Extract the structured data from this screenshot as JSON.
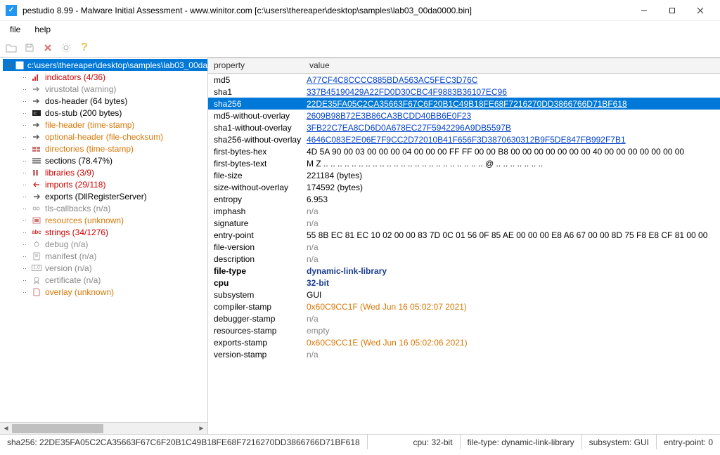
{
  "window": {
    "title": "pestudio 8.99 - Malware Initial Assessment - www.winitor.com [c:\\users\\thereaper\\desktop\\samples\\lab03_00da0000.bin]"
  },
  "menus": {
    "file": "file",
    "help": "help"
  },
  "tree": {
    "root": "c:\\users\\thereaper\\desktop\\samples\\lab03_00da",
    "items": [
      {
        "label": "indicators (4/36)",
        "cls": "c-red",
        "icon": "bars"
      },
      {
        "label": "virustotal (warning)",
        "cls": "c-gray",
        "icon": "arrow-r"
      },
      {
        "label": "dos-header (64 bytes)",
        "cls": "",
        "icon": "arrow-o"
      },
      {
        "label": "dos-stub (200 bytes)",
        "cls": "",
        "icon": "console"
      },
      {
        "label": "file-header (time-stamp)",
        "cls": "c-orange",
        "icon": "arrow-o"
      },
      {
        "label": "optional-header (file-checksum)",
        "cls": "c-orange",
        "icon": "arrow-o"
      },
      {
        "label": "directories (time-stamp)",
        "cls": "c-orange",
        "icon": "dirs"
      },
      {
        "label": "sections (78.47%)",
        "cls": "",
        "icon": "sections"
      },
      {
        "label": "libraries (3/9)",
        "cls": "c-red",
        "icon": "libs"
      },
      {
        "label": "imports (29/118)",
        "cls": "c-red",
        "icon": "imports"
      },
      {
        "label": "exports (DllRegisterServer)",
        "cls": "",
        "icon": "exports"
      },
      {
        "label": "tls-callbacks (n/a)",
        "cls": "c-gray",
        "icon": "chain"
      },
      {
        "label": "resources (unknown)",
        "cls": "c-orange",
        "icon": "res"
      },
      {
        "label": "strings (34/1276)",
        "cls": "c-red",
        "icon": "abc"
      },
      {
        "label": "debug (n/a)",
        "cls": "c-gray",
        "icon": "bug"
      },
      {
        "label": "manifest (n/a)",
        "cls": "c-gray",
        "icon": "manifest"
      },
      {
        "label": "version (n/a)",
        "cls": "c-gray",
        "icon": "ver"
      },
      {
        "label": "certificate (n/a)",
        "cls": "c-gray",
        "icon": "cert"
      },
      {
        "label": "overlay (unknown)",
        "cls": "c-orange",
        "icon": "file"
      }
    ]
  },
  "properties": {
    "headers": {
      "property": "property",
      "value": "value"
    },
    "rows": [
      {
        "prop": "md5",
        "val": "A77CF4C8CCCC885BDA563AC5FEC3D76C",
        "vcls": "c-blue"
      },
      {
        "prop": "sha1",
        "val": "337B45190429A22FD0D30CBC4F9883B36107EC96",
        "vcls": "c-blue"
      },
      {
        "prop": "sha256",
        "val": "22DE35FA05C2CA35663F67C6F20B1C49B18FE68F7216270DD3866766D71BF618",
        "vcls": "c-blue",
        "selected": true
      },
      {
        "prop": "md5-without-overlay",
        "val": "2609B98B72E3B86CA3BCDD40BB6E0F23",
        "vcls": "c-blue"
      },
      {
        "prop": "sha1-without-overlay",
        "val": "3FB22C7EA8CD6D0A678EC27F5942296A9DB5597B",
        "vcls": "c-blue"
      },
      {
        "prop": "sha256-without-overlay",
        "val": "4646C083E2E06E7F9CC2D72010B41F656F3D3870630312B9F5DE847FB992F7B1",
        "vcls": "c-blue"
      },
      {
        "prop": "first-bytes-hex",
        "val": "4D 5A 90 00 03 00 00 00 04 00 00 00 FF FF 00 00 B8 00 00 00 00 00 00 00 40 00 00 00 00 00 00 00",
        "vcls": ""
      },
      {
        "prop": "first-bytes-text",
        "val": "M Z .. .. .. .. .. .. .. .. .. .. .. .. .. .. .. .. .. .. .. .. .. .. .. @ .. .. .. .. .. .. ..",
        "vcls": ""
      },
      {
        "prop": "file-size",
        "val": "221184 (bytes)",
        "vcls": ""
      },
      {
        "prop": "size-without-overlay",
        "val": "174592 (bytes)",
        "vcls": ""
      },
      {
        "prop": "entropy",
        "val": "6.953",
        "vcls": ""
      },
      {
        "prop": "imphash",
        "val": "n/a",
        "vcls": "c-gray"
      },
      {
        "prop": "signature",
        "val": "n/a",
        "vcls": "c-gray"
      },
      {
        "prop": "entry-point",
        "val": "55 8B EC 81 EC 10 02 00 00 83 7D 0C 01 56 0F 85 AE 00 00 00 E8 A6 67 00 00 8D 75 F8 E8 CF 81 00 00",
        "vcls": ""
      },
      {
        "prop": "file-version",
        "val": "n/a",
        "vcls": "c-gray"
      },
      {
        "prop": "description",
        "val": "n/a",
        "vcls": "c-gray"
      },
      {
        "prop": "file-type",
        "val": "dynamic-link-library",
        "vcls": "c-boldblue",
        "pbold": true
      },
      {
        "prop": "cpu",
        "val": "32-bit",
        "vcls": "c-boldblue",
        "pbold": true
      },
      {
        "prop": "subsystem",
        "val": "GUI",
        "vcls": ""
      },
      {
        "prop": "compiler-stamp",
        "val": "0x60C9CC1F (Wed Jun 16 05:02:07 2021)",
        "vcls": "c-orange"
      },
      {
        "prop": "debugger-stamp",
        "val": "n/a",
        "vcls": "c-gray"
      },
      {
        "prop": "resources-stamp",
        "val": "empty",
        "vcls": "c-gray"
      },
      {
        "prop": "exports-stamp",
        "val": "0x60C9CC1E (Wed Jun 16 05:02:06 2021)",
        "vcls": "c-orange"
      },
      {
        "prop": "version-stamp",
        "val": "n/a",
        "vcls": "c-gray"
      }
    ]
  },
  "status": {
    "sha256": "sha256: 22DE35FA05C2CA35663F67C6F20B1C49B18FE68F7216270DD3866766D71BF618",
    "cpu": "cpu: 32-bit",
    "filetype": "file-type: dynamic-link-library",
    "subsystem": "subsystem: GUI",
    "entrypoint": "entry-point: 0"
  }
}
